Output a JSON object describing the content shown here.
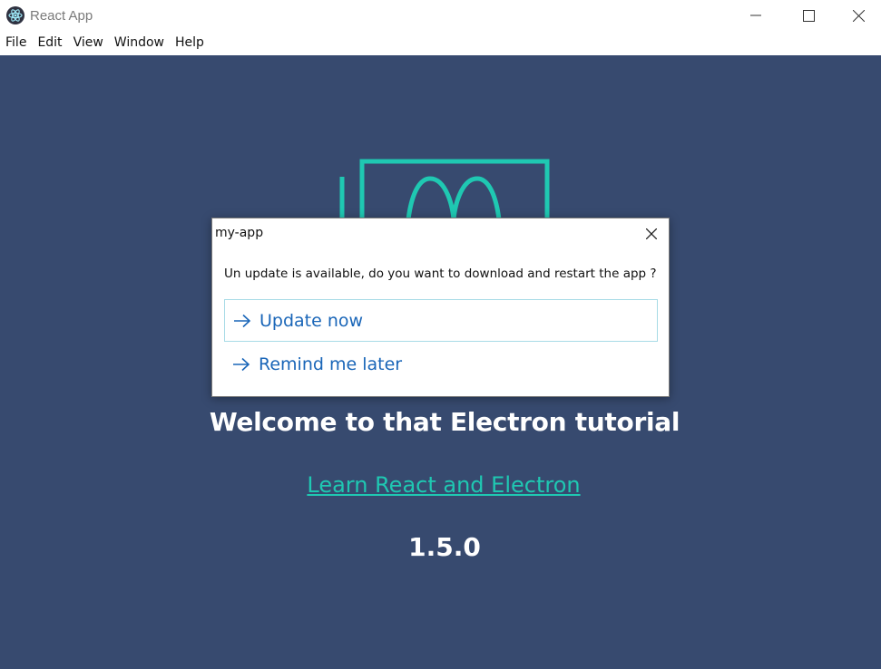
{
  "window": {
    "title": "React App",
    "icon": "electron-icon",
    "controls": [
      "minimize-icon",
      "maximize-icon",
      "close-icon"
    ]
  },
  "menu": {
    "items": [
      "File",
      "Edit",
      "View",
      "Window",
      "Help"
    ]
  },
  "app": {
    "logo": "react-electron-logo",
    "heading": "Welcome to that Electron tutorial",
    "link_text": "Learn React and Electron",
    "version": "1.5.0",
    "background_color": "#374a6f",
    "accent_color": "#1fc8b2"
  },
  "dialog": {
    "title": "my-app",
    "message": "Un update is available, do you want to download and restart the app ?",
    "options": [
      "Update now",
      "Remind me later"
    ],
    "link_color": "#1a66b8"
  }
}
